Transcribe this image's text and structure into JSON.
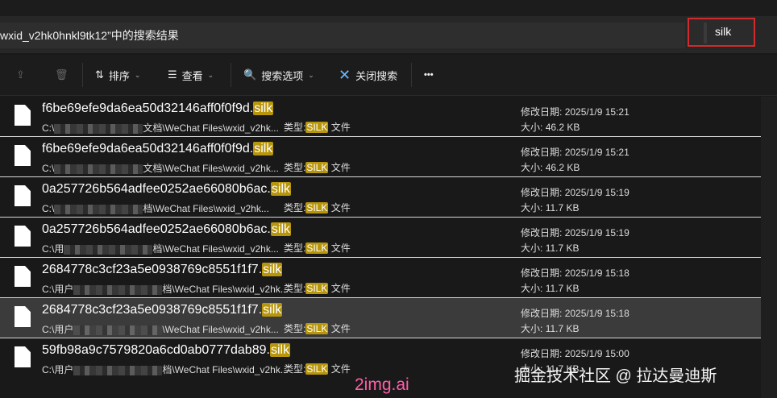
{
  "address": {
    "text": "wxid_v2hk0hnkl9tk12”中的搜索结果"
  },
  "search": {
    "value": "silk"
  },
  "toolbar": {
    "sort": "排序",
    "view": "查看",
    "search_options": "搜索选项",
    "close_search": "关闭搜索",
    "more": "•••"
  },
  "labels": {
    "type": "类型:",
    "type_suffix": "文件",
    "modified": "修改日期:",
    "size": "大小:"
  },
  "files": [
    {
      "stem": "f6be69efe9da6ea50d32146aff0f0f9d.",
      "ext": "silk",
      "path_a": "C:\\",
      "path_b": "文档\\WeChat Files\\wxid_v2hk...",
      "type": "SILK",
      "modified": "2025/1/9 15:21",
      "size": "46.2 KB"
    },
    {
      "stem": "f6be69efe9da6ea50d32146aff0f0f9d.",
      "ext": "silk",
      "path_a": "C:\\",
      "path_b": "文档\\WeChat Files\\wxid_v2hk...",
      "type": "SILK",
      "modified": "2025/1/9 15:21",
      "size": "46.2 KB"
    },
    {
      "stem": "0a257726b564adfee0252ae66080b6ac.",
      "ext": "silk",
      "path_a": "C:\\",
      "path_b": "档\\WeChat Files\\wxid_v2hk...",
      "type": "SILK",
      "modified": "2025/1/9 15:19",
      "size": "11.7 KB"
    },
    {
      "stem": "0a257726b564adfee0252ae66080b6ac.",
      "ext": "silk",
      "path_a": "C:\\用",
      "path_b": "档\\WeChat Files\\wxid_v2hk...",
      "type": "SILK",
      "modified": "2025/1/9 15:19",
      "size": "11.7 KB"
    },
    {
      "stem": "2684778c3cf23a5e0938769c8551f1f7.",
      "ext": "silk",
      "path_a": "C:\\用户",
      "path_b": "档\\WeChat Files\\wxid_v2hk...",
      "type": "SILK",
      "modified": "2025/1/9 15:18",
      "size": "11.7 KB"
    },
    {
      "stem": "2684778c3cf23a5e0938769c8551f1f7.",
      "ext": "silk",
      "path_a": "C:\\用户",
      "path_b": "\\WeChat Files\\wxid_v2hk...",
      "type": "SILK",
      "modified": "2025/1/9 15:18",
      "size": "11.7 KB"
    },
    {
      "stem": "59fb98a9c7579820a6cd0ab0777dab89.",
      "ext": "silk",
      "path_a": "C:\\用户",
      "path_b": "档\\WeChat Files\\wxid_v2hk...",
      "type": "SILK",
      "modified": "2025/1/9 15:00",
      "size": "11.7 KB"
    }
  ],
  "watermark": {
    "site": "2img.ai",
    "credit": "掘金技术社区 @ 拉达曼迪斯"
  }
}
